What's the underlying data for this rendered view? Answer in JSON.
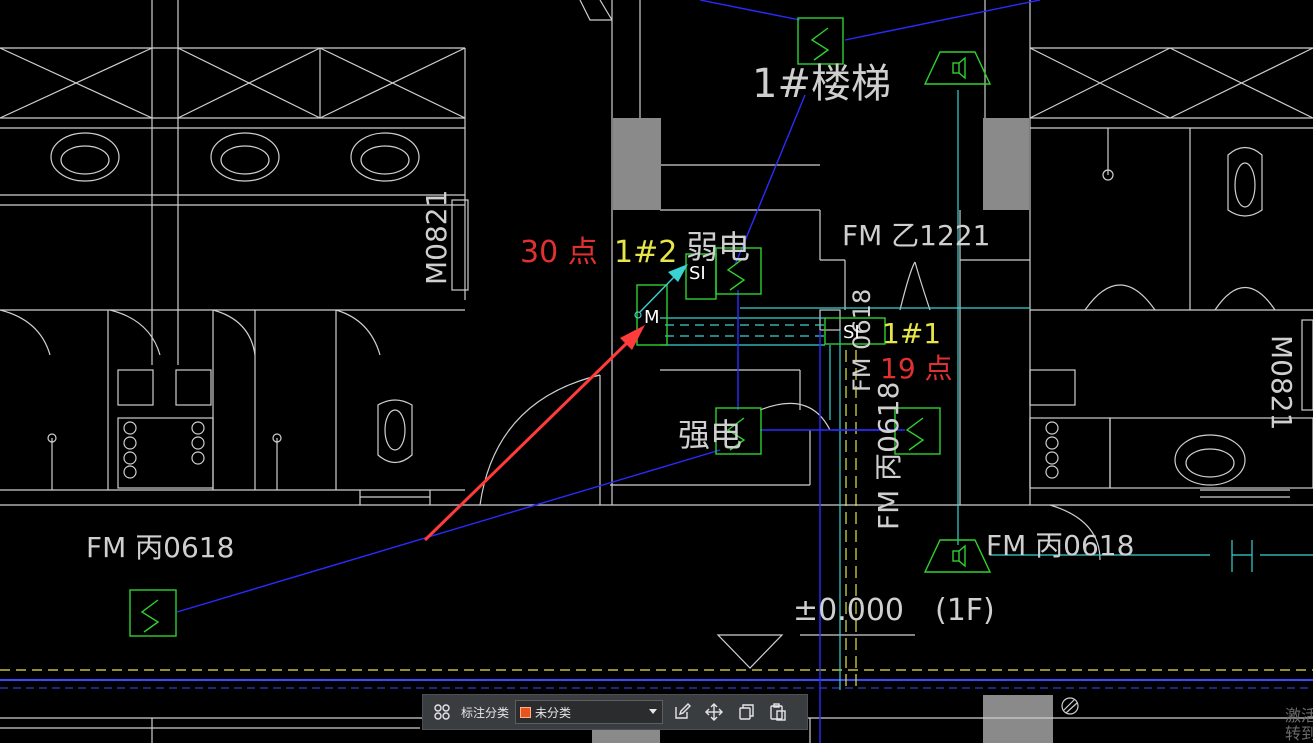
{
  "drawing": {
    "labels": {
      "stair": "1#楼梯",
      "fm_b_1221": "FM 乙1221",
      "m0821_left": "M0821",
      "m0821_right": "M0821",
      "fm_c_0618_left": "FM 丙0618",
      "fm_c_0618_right": "FM 丙0618",
      "fm_c_0618_vertical": "FM 丙0618",
      "fm_0618_vertical_top": "FM 0618",
      "points_left": "30 点",
      "cabinet_left": "1#2",
      "weak_current": "弱电",
      "cabinet_right": "1#1",
      "points_right": "19 点",
      "strong_current": "强电",
      "elevation": "±0.000",
      "floor": "(1F)",
      "device_si_1": "SI",
      "device_si_2": "SI",
      "device_m": "M"
    }
  },
  "toolbar": {
    "category_label": "标注分类",
    "category_value": "未分类",
    "category_color": "#e8541c"
  },
  "watermark": {
    "line1": "激活",
    "line2": "转到"
  }
}
